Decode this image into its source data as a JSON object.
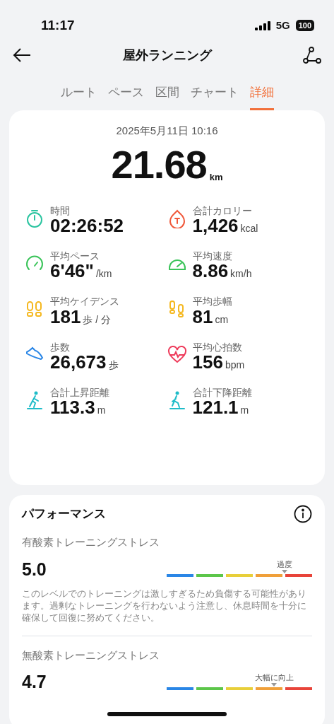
{
  "status_bar": {
    "time": "11:17",
    "network": "5G",
    "battery": "100"
  },
  "header": {
    "title": "屋外ランニング"
  },
  "tabs": [
    {
      "label": "ルート",
      "selected": false
    },
    {
      "label": "ペース",
      "selected": false
    },
    {
      "label": "区間",
      "selected": false
    },
    {
      "label": "チャート",
      "selected": false
    },
    {
      "label": "詳細",
      "selected": true
    }
  ],
  "summary": {
    "datetime": "2025年5月11日 10:16",
    "distance": "21.68",
    "distance_unit": "km"
  },
  "metrics": [
    {
      "label": "時間",
      "value": "02:26:52"
    },
    {
      "label": "合計カロリー",
      "value": "1,426",
      "unit": "kcal"
    },
    {
      "label": "平均ペース",
      "value": "6'46\"",
      "unit": "/km"
    },
    {
      "label": "平均速度",
      "value": "8.86",
      "unit": "km/h"
    },
    {
      "label": "平均ケイデンス",
      "value": "181",
      "unit": "歩 / 分"
    },
    {
      "label": "平均歩幅",
      "value": "81",
      "unit": "cm"
    },
    {
      "label": "歩数",
      "value": "26,673",
      "unit": "歩"
    },
    {
      "label": "平均心拍数",
      "value": "156",
      "unit": "bpm"
    },
    {
      "label": "合計上昇距離",
      "value": "113.3",
      "unit": "m"
    },
    {
      "label": "合計下降距離",
      "value": "121.1",
      "unit": "m"
    }
  ],
  "performance": {
    "title": "パフォーマンス",
    "items": [
      {
        "label": "有酸素トレーニングストレス",
        "value": "5.0",
        "marker_label": "過度",
        "level": 0.81,
        "description": "このレベルでのトレーニングは激しすぎるため負傷する可能性があります。過剰なトレーニングを行わないよう注意し、休息時間を十分に確保して回復に努めてください。"
      },
      {
        "label": "無酸素トレーニングストレス",
        "value": "4.7",
        "marker_label": "大幅に向上",
        "level": 0.74
      }
    ]
  }
}
